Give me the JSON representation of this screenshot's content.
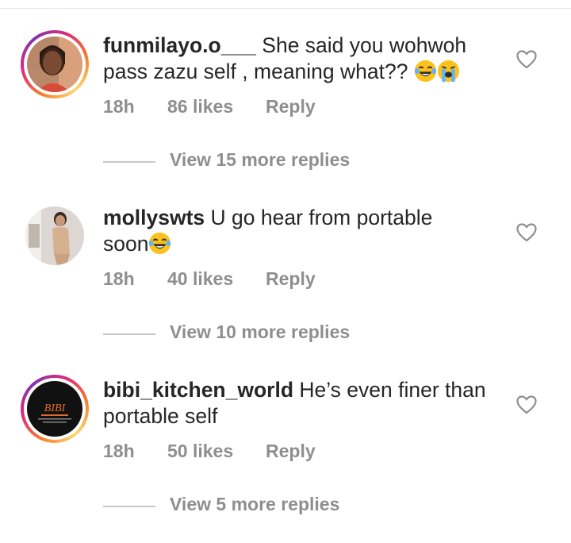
{
  "theme": {
    "text": "#262626",
    "muted": "#8e8e8e",
    "story_ring": [
      "#f58529",
      "#dd2a7b",
      "#8134af"
    ]
  },
  "comments": [
    {
      "username": "funmilayo.o___",
      "text_line1": "She said you wohwoh",
      "text_line2": "pass zazu self , meaning what?? ",
      "emojis": [
        "face-with-tears-of-joy",
        "loudly-crying-face"
      ],
      "time": "18h",
      "likes": "86 likes",
      "reply": "Reply",
      "view_replies": "View 15 more replies"
    },
    {
      "username": "mollyswts",
      "text_line1": "U go hear from portable",
      "text_line2": "soon",
      "emojis": [
        "face-with-tears-of-joy"
      ],
      "time": "18h",
      "likes": "40 likes",
      "reply": "Reply",
      "view_replies": "View 10 more replies"
    },
    {
      "username": "bibi_kitchen_world",
      "text_line1": "He’s even finer than",
      "text_line2": "portable self",
      "emojis": [],
      "time": "18h",
      "likes": "50 likes",
      "reply": "Reply",
      "view_replies": "View 5 more replies",
      "avatar_logo": "BIBI"
    }
  ]
}
